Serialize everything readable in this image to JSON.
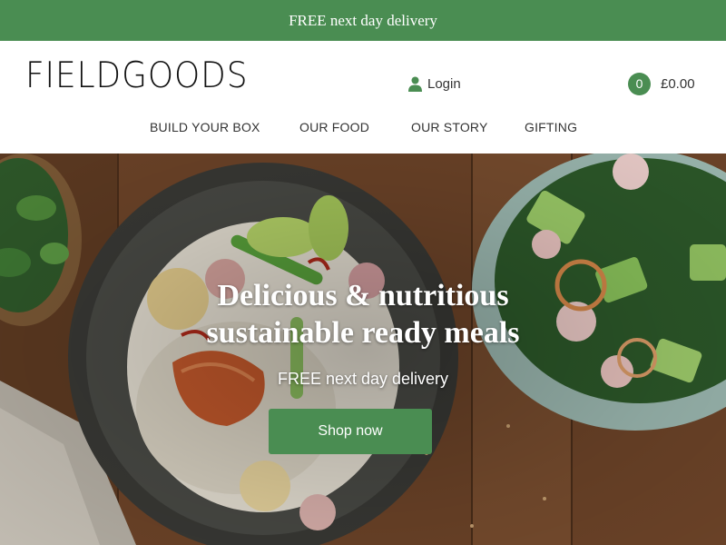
{
  "promo": {
    "text": "FREE next day delivery"
  },
  "header": {
    "logo": "FIELDGOODS",
    "login_label": "Login",
    "cart": {
      "count": "0",
      "total": "£0.00"
    }
  },
  "nav": {
    "items": [
      {
        "label": "BUILD YOUR BOX"
      },
      {
        "label": "OUR FOOD"
      },
      {
        "label": "OUR STORY"
      },
      {
        "label": "GIFTING"
      }
    ]
  },
  "hero": {
    "title_line1": "Delicious & nutritious",
    "title_line2": "sustainable ready meals",
    "subtitle": "FREE next day delivery",
    "button_label": "Shop now"
  },
  "colors": {
    "brand_green": "#4a8d52",
    "wood": "#6e452a",
    "text_dark": "#333333"
  },
  "icons": {
    "login": "user-icon"
  }
}
